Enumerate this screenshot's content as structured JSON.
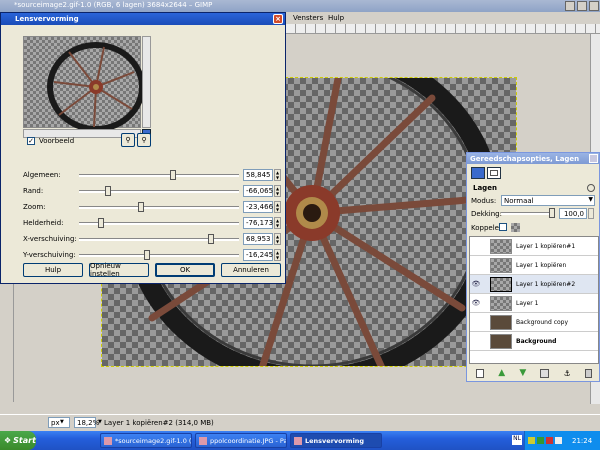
{
  "window": {
    "title": "*sourceimage2.gif-1.0 (RGB, 6 lagen) 3684x2644 – GIMP",
    "menu": [
      "Vensters",
      "Hulp"
    ]
  },
  "dialog": {
    "title": "Lensvervorming",
    "preview_label": "Voorbeeld",
    "sliders": [
      {
        "label": "Algemeen:",
        "value": "58,845",
        "fraction": 0.59
      },
      {
        "label": "Rand:",
        "value": "-66,065",
        "fraction": 0.17
      },
      {
        "label": "Zoom:",
        "value": "-23,466",
        "fraction": 0.38
      },
      {
        "label": "Helderheid:",
        "value": "-76,173",
        "fraction": 0.12
      },
      {
        "label": "X-verschuiving:",
        "value": "68,953",
        "fraction": 0.84
      },
      {
        "label": "Y-verschuiving:",
        "value": "-16,245",
        "fraction": 0.42
      }
    ],
    "buttons": {
      "help": "Hulp",
      "reset": "Opnieuw instellen",
      "ok": "OK",
      "cancel": "Annuleren"
    }
  },
  "layers_panel": {
    "title": "Gereedschapsopties, Lagen",
    "tab_label": "Lagen",
    "mode_label": "Modus:",
    "mode_value": "Normaal",
    "opacity_label": "Dekking:",
    "opacity_value": "100,0",
    "opacity_fraction": 1.0,
    "lock_label": "Koppelen:",
    "layers": [
      {
        "name": "Layer 1 kopiëren#1",
        "visible": false,
        "bold": false,
        "selected": false
      },
      {
        "name": "Layer 1 kopiëren",
        "visible": false,
        "bold": false,
        "selected": false
      },
      {
        "name": "Layer 1 kopiëren#2",
        "visible": true,
        "bold": false,
        "selected": true
      },
      {
        "name": "Layer 1",
        "visible": true,
        "bold": false,
        "selected": false
      },
      {
        "name": "Background copy",
        "visible": false,
        "bold": false,
        "selected": false
      },
      {
        "name": "Background",
        "visible": false,
        "bold": true,
        "selected": false
      }
    ]
  },
  "statusbar": {
    "unit": "px",
    "zoom": "18,2%",
    "info": "Layer 1 kopiëren#2 (314,0 MB)"
  },
  "taskbar": {
    "start": "Start",
    "items": [
      {
        "label": "*sourceimage2.gif-1.0 (...",
        "active": false
      },
      {
        "label": "ppolcoordinatie.JPG - Paint",
        "active": false
      },
      {
        "label": "Lensvervorming",
        "active": true
      }
    ],
    "lang": "NL",
    "time": "21:24"
  },
  "colors": {
    "xp_blue": "#2a64d8",
    "taskbar": "#245edb",
    "tray": "#0f8ded"
  }
}
